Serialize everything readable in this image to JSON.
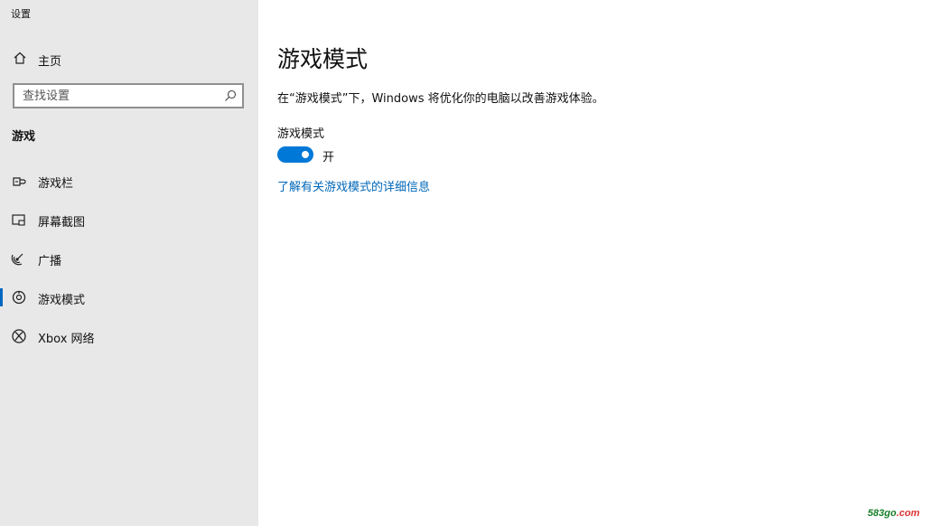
{
  "window": {
    "title": "设置"
  },
  "sidebar": {
    "home": {
      "label": "主页",
      "icon": "home-icon"
    },
    "search": {
      "placeholder": "查找设置",
      "value": "",
      "icon": "search-icon"
    },
    "section_title": "游戏",
    "items": [
      {
        "label": "游戏栏",
        "icon": "game-bar-icon",
        "selected": false
      },
      {
        "label": "屏幕截图",
        "icon": "screen-capture-icon",
        "selected": false
      },
      {
        "label": "广播",
        "icon": "broadcast-icon",
        "selected": false
      },
      {
        "label": "游戏模式",
        "icon": "game-mode-icon",
        "selected": true
      },
      {
        "label": "Xbox 网络",
        "icon": "xbox-icon",
        "selected": false
      }
    ]
  },
  "main": {
    "title": "游戏模式",
    "description": "在“游戏模式”下，Windows 将优化你的电脑以改善游戏体验。",
    "setting_label": "游戏模式",
    "toggle": {
      "state": "on",
      "state_label": "开"
    },
    "link": "了解有关游戏模式的详细信息"
  },
  "watermark": {
    "text": "583go",
    "domain": ".com"
  },
  "colors": {
    "accent": "#0078d7",
    "link": "#0067b8",
    "sidebar_bg": "#e8e8e8",
    "main_bg": "#ffffff"
  }
}
